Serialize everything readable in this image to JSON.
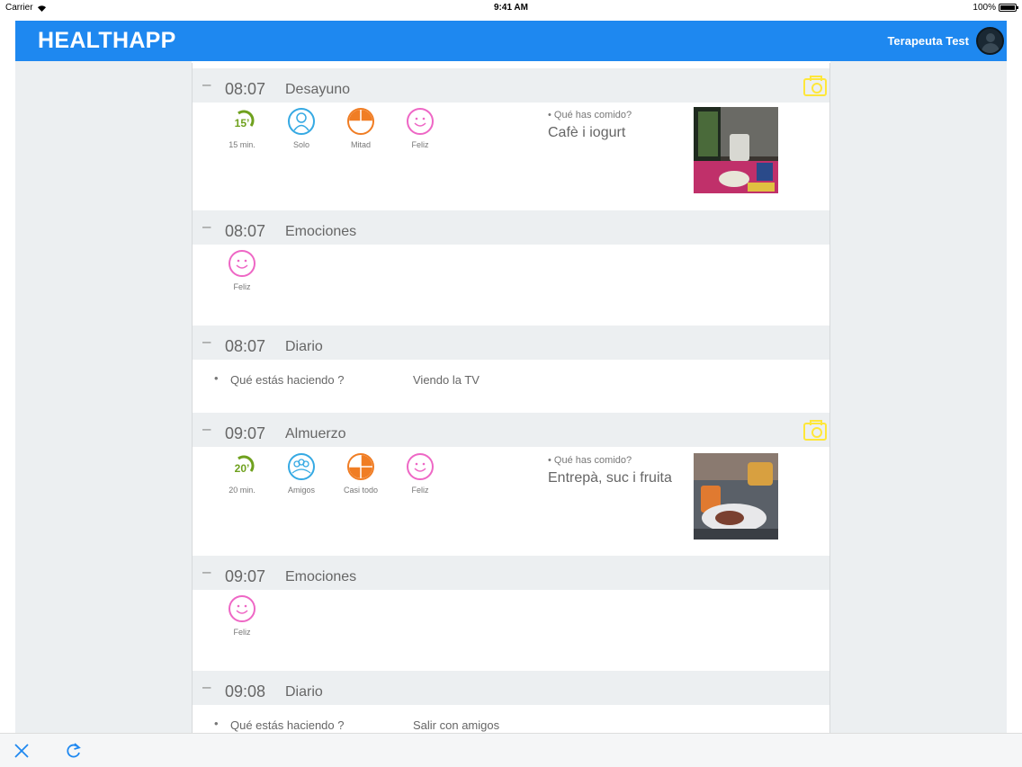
{
  "status_bar": {
    "carrier": "Carrier",
    "time": "9:41 AM",
    "battery": "100%"
  },
  "header": {
    "logo": "HEALTHAPP",
    "user": "Terapeuta Test"
  },
  "sections": [
    {
      "dash": "–",
      "time": "08:07",
      "title": "Desayuno",
      "icons": [
        {
          "badge": "15’",
          "label": "15 min."
        },
        {
          "label": "Solo"
        },
        {
          "label": "Mitad"
        },
        {
          "label": "Feliz"
        }
      ],
      "question": "• Qué has comido?",
      "answer": "Cafè i iogurt"
    },
    {
      "dash": "–",
      "time": "08:07",
      "title": "Emociones",
      "icons": [
        {
          "label": "Feliz"
        }
      ]
    },
    {
      "dash": "–",
      "time": "08:07",
      "title": "Diario",
      "bullet": "•",
      "question": "Qué estás haciendo ?",
      "answer": "Viendo la TV"
    },
    {
      "dash": "–",
      "time": "09:07",
      "title": "Almuerzo",
      "icons": [
        {
          "badge": "20’",
          "label": "20 min."
        },
        {
          "label": "Amigos"
        },
        {
          "label": "Casi todo"
        },
        {
          "label": "Feliz"
        }
      ],
      "question": "• Qué has comido?",
      "answer": "Entrepà, suc i fruita"
    },
    {
      "dash": "–",
      "time": "09:07",
      "title": "Emociones",
      "icons": [
        {
          "label": "Feliz"
        }
      ]
    },
    {
      "dash": "–",
      "time": "09:08",
      "title": "Diario",
      "bullet": "•",
      "question": "Qué estás haciendo ?",
      "answer": "Salir con amigos"
    }
  ],
  "icons": {
    "close": "close-icon",
    "refresh": "refresh-icon",
    "camera": "camera-icon",
    "wifi": "wifi-icon",
    "battery": "battery-icon",
    "avatar": "avatar-icon"
  },
  "colors": {
    "header": "#1e88f0",
    "time_green": "#6fa11e",
    "blue": "#35a9e3",
    "orange": "#f07d24",
    "pink": "#ee67c5",
    "camera_yellow": "#ffe73a"
  }
}
